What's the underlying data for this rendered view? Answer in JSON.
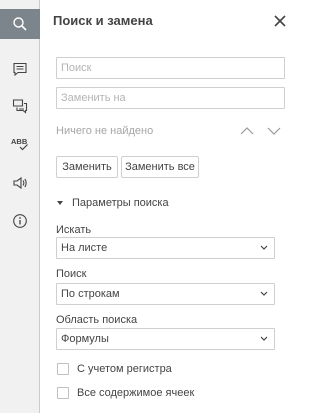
{
  "panel": {
    "title": "Поиск и замена",
    "close_icon": "close-icon"
  },
  "rail": {
    "items": [
      {
        "name": "search",
        "icon": "search-icon",
        "active": true
      },
      {
        "name": "comments",
        "icon": "comment-icon",
        "active": false
      },
      {
        "name": "chat",
        "icon": "chat-icon",
        "active": false
      },
      {
        "name": "spellcheck",
        "icon": "spellcheck-icon",
        "active": false
      },
      {
        "name": "feedback",
        "icon": "megaphone-icon",
        "active": false
      },
      {
        "name": "about",
        "icon": "info-icon",
        "active": false
      }
    ]
  },
  "search": {
    "find_placeholder": "Поиск",
    "replace_placeholder": "Заменить на",
    "status": "Ничего не найдено"
  },
  "actions": {
    "replace_label": "Заменить",
    "replace_all_label": "Заменить все"
  },
  "options": {
    "section_title": "Параметры поиска",
    "within_label": "Искать",
    "within_value": "На листе",
    "search_label": "Поиск",
    "search_value": "По строкам",
    "lookin_label": "Область поиска",
    "lookin_value": "Формулы",
    "match_case_label": "С учетом регистра",
    "match_case_checked": false,
    "entire_cell_label": "Все содержимое ячеек",
    "entire_cell_checked": false
  }
}
